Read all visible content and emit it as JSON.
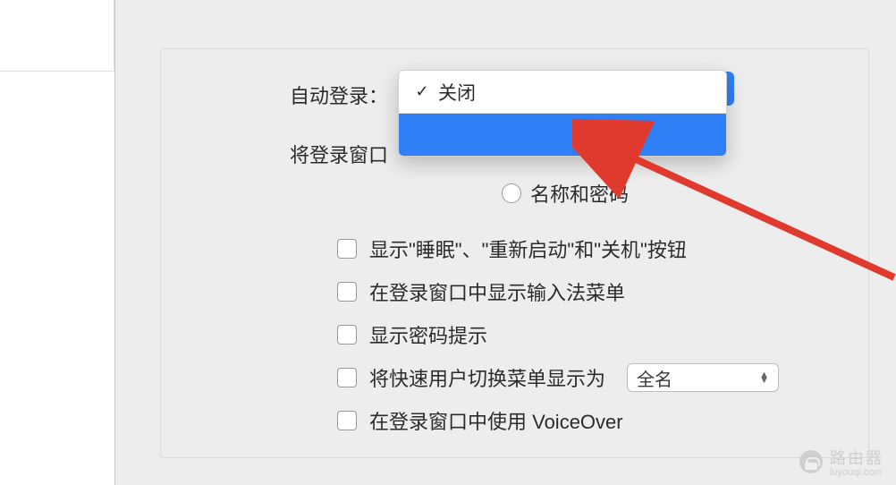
{
  "labels": {
    "auto_login": "自动登录：",
    "login_window_as": "将登录窗口"
  },
  "dropdown": {
    "selected_label": "关闭",
    "hover_label": " "
  },
  "radio": {
    "name_password": "名称和密码"
  },
  "options": {
    "show_sleep_restart_shutdown": "显示\"睡眠\"、\"重新启动\"和\"关机\"按钮",
    "show_ime_menu": "在登录窗口中显示输入法菜单",
    "show_password_hints": "显示密码提示",
    "fast_user_switch": "将快速用户切换菜单显示为",
    "voiceover": "在登录窗口中使用 VoiceOver"
  },
  "fast_user_switch_select": {
    "value": "全名"
  },
  "watermark": {
    "title": "路由器",
    "sub": "luyouqi.com"
  }
}
